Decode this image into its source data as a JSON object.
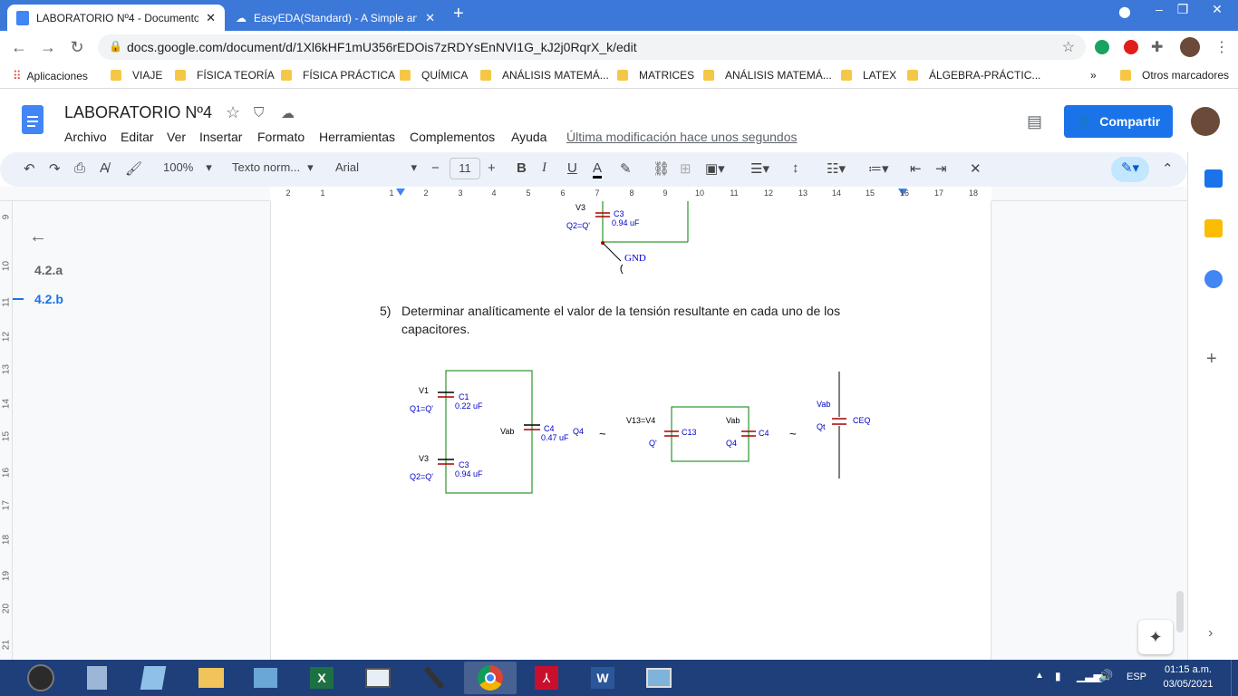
{
  "browser": {
    "tabs": [
      {
        "title": "LABORATORIO Nº4 - Documento",
        "active": true
      },
      {
        "title": "EasyEDA(Standard) - A Simple an",
        "active": false
      }
    ],
    "new_tab": "+",
    "url": "docs.google.com/document/d/1Xl6kHF1mU356rEDOis7zRDYsEnNVI1G_kJ2j0RqrX_k/edit"
  },
  "bookmarks": {
    "apps_label": "Aplicaciones",
    "items": [
      "VIAJE",
      "FÍSICA TEORÍA",
      "FÍSICA PRÁCTICA",
      "QUÍMICA",
      "ANÁLISIS MATEMÁ...",
      "MATRICES",
      "ANÁLISIS MATEMÁ...",
      "LATEX",
      "ÁLGEBRA-PRÁCTIC..."
    ],
    "overflow": "»",
    "other": "Otros marcadores"
  },
  "doc": {
    "title": "LABORATORIO Nº4",
    "menus": [
      "Archivo",
      "Editar",
      "Ver",
      "Insertar",
      "Formato",
      "Herramientas",
      "Complementos",
      "Ayuda"
    ],
    "last_edit": "Última modificación hace unos segundos",
    "share_label": "Compartir"
  },
  "toolbar": {
    "zoom": "100%",
    "style": "Texto norm...",
    "font": "Arial",
    "font_size": "11"
  },
  "ruler": {
    "ticks": [
      "2",
      "1",
      "1",
      "2",
      "3",
      "4",
      "5",
      "6",
      "7",
      "8",
      "9",
      "10",
      "11",
      "12",
      "13",
      "14",
      "15",
      "16",
      "17",
      "18"
    ]
  },
  "vruler": {
    "ticks": [
      "9",
      "10",
      "11",
      "12",
      "13",
      "14",
      "15",
      "16",
      "17",
      "18",
      "19",
      "20",
      "21"
    ]
  },
  "outline": {
    "items": [
      {
        "label": "4.2.a",
        "active": false
      },
      {
        "label": "4.2.b",
        "active": true
      }
    ]
  },
  "content": {
    "item_number": "5)",
    "paragraph_line1": "Determinar analíticamente el valor de la tensión resultante en cada uno de los",
    "paragraph_line2": "capacitores.",
    "top_circuit": {
      "v3": "V3",
      "q2": "Q2=Q'",
      "c3": "C3",
      "c3_val": "0.94 uF",
      "gnd": "GND"
    },
    "circuit_a": {
      "v1": "V1",
      "q1": "Q1=Q'",
      "c1": "C1",
      "c1_val": "0.22 uF",
      "v3": "V3",
      "q2": "Q2=Q'",
      "c3": "C3",
      "c3_val": "0.94 uF",
      "vab": "Vab",
      "c4": "C4",
      "c4_val": "0.47 uF",
      "q4": "Q4"
    },
    "tilde": "~",
    "circuit_b": {
      "v13": "V13=V4",
      "qp": "Q'",
      "c13": "C13",
      "vab": "Vab",
      "q4": "Q4",
      "c4": "C4"
    },
    "circuit_c": {
      "vab": "Vab",
      "qt": "Qt",
      "ceq": "CEQ"
    }
  },
  "taskbar": {
    "lang": "ESP",
    "time": "01:15 a.m.",
    "date": "03/05/2021"
  },
  "colors": {
    "brand": "#1a73e8",
    "tabstrip": "#3c78d8",
    "taskbar": "#1e3f7a",
    "wire": "#008000",
    "label_blue": "#0000cc"
  }
}
